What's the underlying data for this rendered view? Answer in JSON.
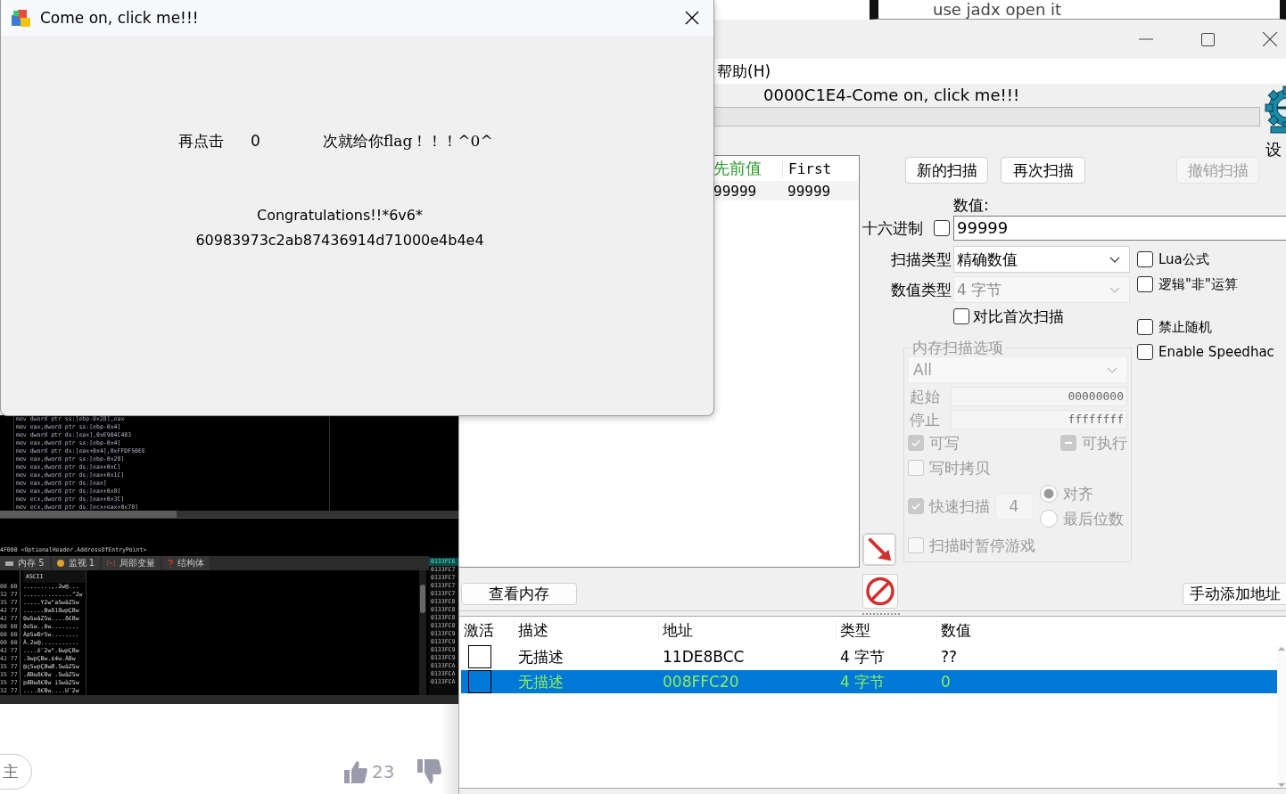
{
  "background_window": {
    "text": "use jadx open it"
  },
  "dialog": {
    "title": "Come on, click me!!!",
    "prompt_prefix": "再点击",
    "click_count": "0",
    "prompt_suffix": "次就给你flag！！！^0^",
    "message": "Congratulations!!*6v6*",
    "flag": "60983973c2ab87436914d71000e4b4e4"
  },
  "debugger_screenshot": {
    "disassembly": [
      "mov dword ptr ss:[ebp-0x28],eax",
      "mov eax,dword ptr ss:[ebp-0x4]",
      "mov dword ptr ds:[eax],0xE904C483",
      "mov eax,dword ptr ss:[ebp-0x4]",
      "mov dword ptr ds:[eax+0x4],0xFFDF50EE",
      "mov eax,dword ptr ss:[ebp-0x28]",
      "mov eax,dword ptr ds:[eax+0xC]",
      "mov eax,dword ptr ds:[eax+0x1C]",
      "mov eax,dword ptr ds:[eax]",
      "mov eax,dword ptr ds:[eax+0x8]",
      "mov ecx,dword ptr ds:[eax+0x3C]",
      "mov ecx,dword ptr ds:[ecx+eax+0x78]"
    ],
    "address_line": "4F000 <OptionalHeader.AddressOfEntryPoint>",
    "tabs": [
      {
        "kind": "chip",
        "label": "内存 5"
      },
      {
        "kind": "badge",
        "label": "监视 1"
      },
      {
        "kind": "bracket",
        "label": "局部变量"
      },
      {
        "kind": "hook",
        "label": "结构体"
      }
    ],
    "dump_header": "ASCII",
    "dump_rows": [
      {
        "bytes": "00 00",
        "ascii": "........,.2w@..."
      },
      {
        "bytes": "32 77",
        "ascii": "..............\"2w"
      },
      {
        "bytes": "35 77",
        "ascii": ".....Y2w\"a5wàZ5w"
      },
      {
        "bytes": "42 77",
        "ascii": "......Bwð18wpÇBw"
      },
      {
        "bytes": "42 77",
        "ascii": "0w5wàZ5w....ð€Bw"
      },
      {
        "bytes": "00 00",
        "ascii": "ðe5w..6w........"
      },
      {
        "bytes": "00 00",
        "ascii": "Àp5wÐr5w........"
      },
      {
        "bytes": "00 00",
        "ascii": "À.2w@..........."
      },
      {
        "bytes": "42 77",
        "ascii": "....è¨2w°.6wpÇBw"
      },
      {
        "bytes": "42 77",
        "ascii": ".9wpÇBw.¢4w.ÀBw"
      },
      {
        "bytes": "35 77",
        "ascii": "@ç5wpÇBwØ.5wàZ5w"
      },
      {
        "bytes": "35 77",
        "ascii": ".ÆBwð€Bw .5wàZ5w"
      },
      {
        "bytes": "35 77",
        "ascii": "pÆBwð€Bw i5wàZ5w"
      },
      {
        "bytes": "32 77",
        "ascii": "....ð€Bw....U¨2w"
      }
    ],
    "stack_addresses": [
      {
        "address": "0133FC6",
        "selected": true
      },
      {
        "address": "0133FC7",
        "selected": false
      },
      {
        "address": "0133FC7",
        "selected": false
      },
      {
        "address": "0133FC7",
        "selected": false
      },
      {
        "address": "0133FC7",
        "selected": false
      },
      {
        "address": "0133FC8",
        "selected": false
      },
      {
        "address": "0133FC8",
        "selected": false
      },
      {
        "address": "0133FC8",
        "selected": false
      },
      {
        "address": "0133FC8",
        "selected": false
      },
      {
        "address": "0133FC9",
        "selected": false
      },
      {
        "address": "0133FC9",
        "selected": false
      },
      {
        "address": "0133FC9",
        "selected": false
      },
      {
        "address": "0133FC9",
        "selected": false
      },
      {
        "address": "0133FCA",
        "selected": false
      },
      {
        "address": "0133FCA",
        "selected": false
      },
      {
        "address": "0133FCA",
        "selected": false
      }
    ]
  },
  "web_page": {
    "follow_button": "主",
    "like_count": "23"
  },
  "cheat_engine": {
    "menu": [
      "帮助(H)"
    ],
    "process": "0000C1E4-Come on, click me!!!",
    "logo_caption": "设",
    "found_list": {
      "columns": [
        "先前值",
        "First"
      ],
      "rows": [
        [
          "99999",
          "99999"
        ]
      ]
    },
    "scan_buttons": [
      {
        "label": "新的扫描",
        "disabled": false
      },
      {
        "label": "再次扫描",
        "disabled": false
      },
      {
        "label": "撤销扫描",
        "disabled": true
      }
    ],
    "value_label": "数值:",
    "hex": {
      "label": "十六进制",
      "checked": false
    },
    "value": "99999",
    "scan_type": {
      "label": "扫描类型",
      "value": "精确数值",
      "disabled": false
    },
    "value_type": {
      "label": "数值类型",
      "value": "4 字节",
      "disabled": true
    },
    "compare_first": {
      "label": "对比首次扫描",
      "checked": false
    },
    "options": [
      {
        "label": "Lua公式",
        "checked": false
      },
      {
        "label": "逻辑\"非\"运算",
        "checked": false
      },
      {
        "label": "禁止随机",
        "checked": false
      },
      {
        "label": "Enable Speedhac",
        "checked": false
      }
    ],
    "memory_options": {
      "title": "内存扫描选项",
      "disabled": true,
      "region": "All",
      "start_label": "起始",
      "start": "00000000",
      "stop_label": "停止",
      "stop": "ffffffff",
      "writable": {
        "label": "可写",
        "checked": true
      },
      "executable": {
        "label": "可执行",
        "checked": false,
        "indeterminate": true
      },
      "copy_on_write": {
        "label": "写时拷贝",
        "checked": false
      },
      "fast_scan": {
        "label": "快速扫描",
        "checked": true,
        "value": "4"
      },
      "alignment": [
        {
          "label": "对齐",
          "selected": true
        },
        {
          "label": "最后位数",
          "selected": false
        }
      ],
      "pause": {
        "label": "扫描时暂停游戏",
        "checked": false
      }
    },
    "memory_view_button": "查看内存",
    "add_address_button": "手动添加地址",
    "table": {
      "columns": [
        "激活",
        "描述",
        "地址",
        "类型",
        "数值"
      ],
      "rows": [
        {
          "active": false,
          "selected": false,
          "description": "无描述",
          "address": "11DE8BCC",
          "type": "4 字节",
          "value": "??"
        },
        {
          "active": false,
          "selected": true,
          "description": "无描述",
          "address": "008FFC20",
          "type": "4 字节",
          "value": "0"
        }
      ]
    }
  }
}
